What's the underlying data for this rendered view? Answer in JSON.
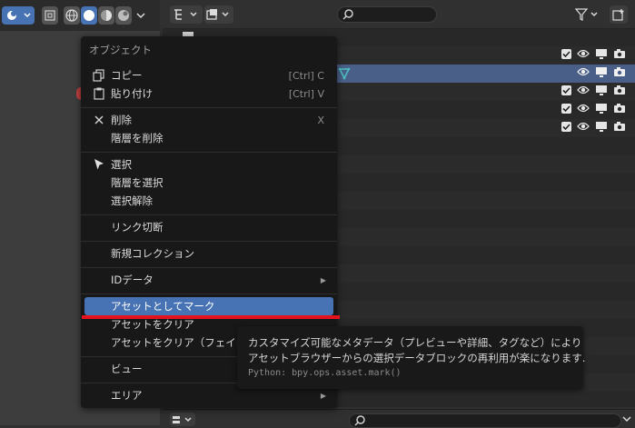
{
  "menu": {
    "title": "オブジェクト",
    "items": [
      {
        "label": "コピー",
        "shortcut": "[Ctrl] C",
        "icon": "copy-icon"
      },
      {
        "label": "貼り付け",
        "shortcut": "[Ctrl] V",
        "icon": "paste-icon"
      },
      {
        "label": "削除",
        "shortcut": "X",
        "icon": "x-icon"
      },
      {
        "label": "階層を削除"
      },
      {
        "label": "選択",
        "icon": "cursor-icon"
      },
      {
        "label": "階層を選択"
      },
      {
        "label": "選択解除"
      },
      {
        "label": "リンク切断"
      },
      {
        "label": "新規コレクション"
      },
      {
        "label": "IDデータ",
        "submenu": true
      },
      {
        "label": "アセットとしてマーク",
        "active": true
      },
      {
        "label": "アセットをクリア"
      },
      {
        "label": "アセットをクリア（フェイク"
      },
      {
        "label": "ビュー"
      },
      {
        "label": "エリア",
        "submenu": true
      }
    ]
  },
  "tooltip": {
    "line1": "カスタマイズ可能なメタデータ（プレビューや詳細、タグなど）により",
    "line2": "アセットブラウザーからの選択データブロックの再利用が楽になります.",
    "python": "Python: bpy.ops.asset.mark()"
  },
  "colors": {
    "accent": "#4772b3",
    "underline": "#e4121c",
    "mesh_icon": "#4cc3c3"
  }
}
